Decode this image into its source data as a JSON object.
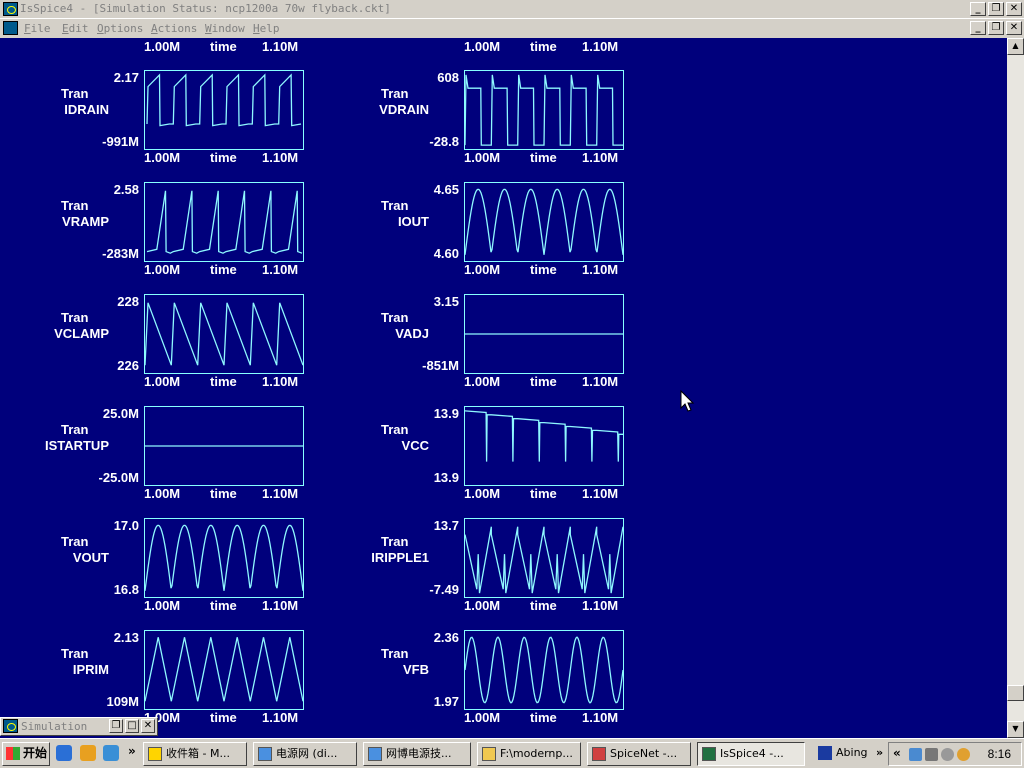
{
  "window": {
    "title": "IsSpice4 - [Simulation Status: ncp1200a 70w flyback.ckt]"
  },
  "menu": {
    "items": [
      "File",
      "Edit",
      "Options",
      "Actions",
      "Window",
      "Help"
    ]
  },
  "axis": {
    "xmin": "1.00M",
    "xlabel": "time",
    "xmax": "1.10M"
  },
  "colors": {
    "plot_background": "#00007c",
    "trace": "#8ff8ff",
    "text": "#ffffff"
  },
  "plots": [
    {
      "analysis": "Tran",
      "name": "IDRAIN",
      "ymax": "2.17",
      "ymin": "-991M",
      "shape": "pulse"
    },
    {
      "analysis": "Tran",
      "name": "VDRAIN",
      "ymax": "608",
      "ymin": "-28.8",
      "shape": "drain"
    },
    {
      "analysis": "Tran",
      "name": "VRAMP",
      "ymax": "2.58",
      "ymin": "-283M",
      "shape": "ramp"
    },
    {
      "analysis": "Tran",
      "name": "IOUT",
      "ymax": "4.65",
      "ymin": "4.60",
      "shape": "arches"
    },
    {
      "analysis": "Tran",
      "name": "VCLAMP",
      "ymax": "228",
      "ymin": "226",
      "shape": "saw_down"
    },
    {
      "analysis": "Tran",
      "name": "VADJ",
      "ymax": "3.15",
      "ymin": "-851M",
      "shape": "flat"
    },
    {
      "analysis": "Tran",
      "name": "ISTARTUP",
      "ymax": "25.0M",
      "ymin": "-25.0M",
      "shape": "flat_mid"
    },
    {
      "analysis": "Tran",
      "name": "VCC",
      "ymax": "13.9",
      "ymin": "13.9",
      "shape": "steps"
    },
    {
      "analysis": "Tran",
      "name": "VOUT",
      "ymax": "17.0",
      "ymin": "16.8",
      "shape": "arches"
    },
    {
      "analysis": "Tran",
      "name": "IRIPPLE1",
      "ymax": "13.7",
      "ymin": "-7.49",
      "shape": "ripple"
    },
    {
      "analysis": "Tran",
      "name": "IPRIM",
      "ymax": "2.13",
      "ymin": "109M",
      "shape": "triangle"
    },
    {
      "analysis": "Tran",
      "name": "VFB",
      "ymax": "2.36",
      "ymin": "1.97",
      "shape": "sine"
    }
  ],
  "minimized_window": {
    "title": "Simulation"
  },
  "taskbar": {
    "start_label": "开始",
    "buttons": [
      "收件箱 - M...",
      "电源网 (di...",
      "网博电源技...",
      "F:\\modernp...",
      "SpiceNet -...",
      "IsSpice4 -...",
      "Abing"
    ],
    "clock": "8:16"
  }
}
